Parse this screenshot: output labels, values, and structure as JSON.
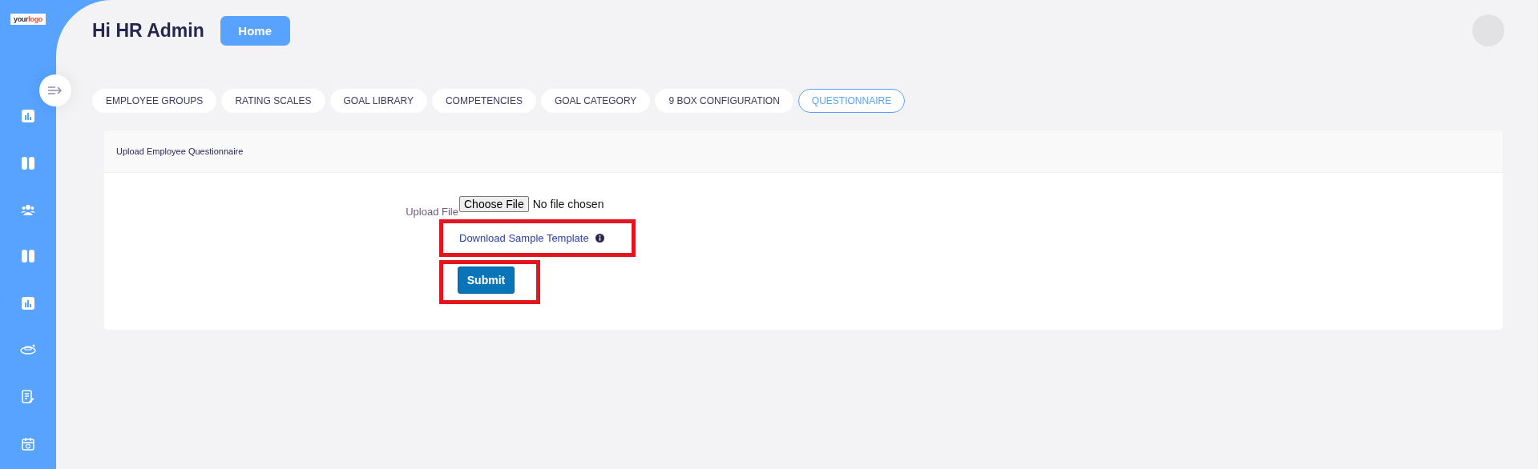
{
  "logo": {
    "part1": "your",
    "part2": "logo"
  },
  "header": {
    "greeting": "Hi HR Admin",
    "home_button": "Home"
  },
  "tabs": [
    {
      "label": "EMPLOYEE GROUPS",
      "selected": false
    },
    {
      "label": "RATING SCALES",
      "selected": false
    },
    {
      "label": "GOAL LIBRARY",
      "selected": false
    },
    {
      "label": "COMPETENCIES",
      "selected": false
    },
    {
      "label": "GOAL CATEGORY",
      "selected": false
    },
    {
      "label": "9 BOX CONFIGURATION",
      "selected": false
    },
    {
      "label": "QUESTIONNAIRE",
      "selected": true
    }
  ],
  "card": {
    "title": "Upload Employee Questionnaire",
    "upload_label": "Upload File",
    "file_button": "Choose File",
    "file_status": "No file chosen",
    "download_link": {
      "label": "Download Sample Template",
      "highlighted": true
    },
    "submit": {
      "label": "Submit",
      "highlighted": true
    }
  }
}
